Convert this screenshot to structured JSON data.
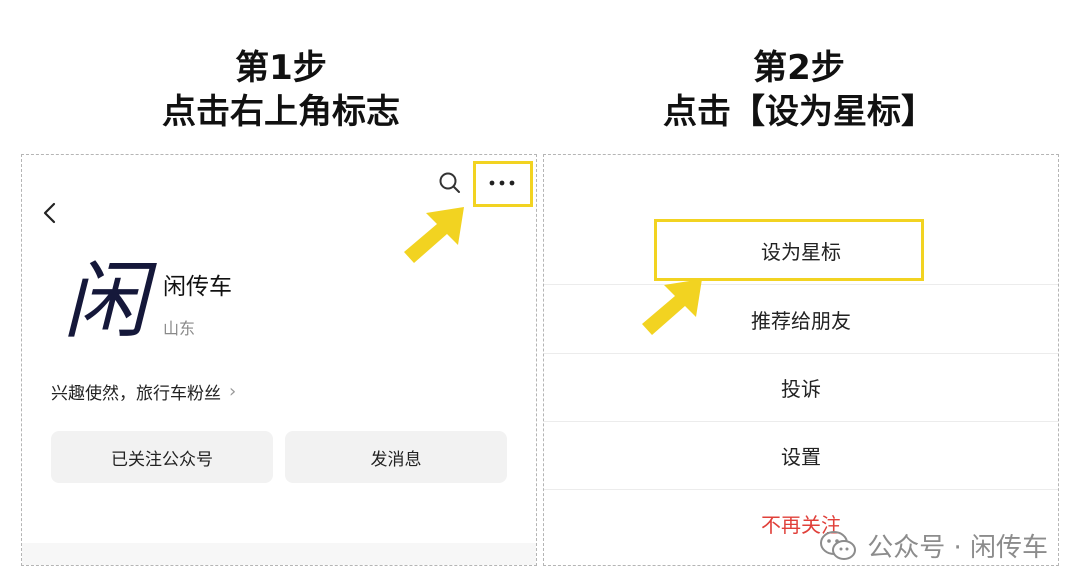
{
  "step1": {
    "title": "第1步",
    "subtitle": "点击右上角标志"
  },
  "step2": {
    "title": "第2步",
    "subtitle": "点击【设为星标】"
  },
  "profile": {
    "avatar_char": "闲",
    "name": "闲传车",
    "region": "山东",
    "description": "兴趣使然，旅行车粉丝",
    "follow_button": "已关注公众号",
    "message_button": "发消息",
    "icons": [
      "back-icon",
      "search-icon",
      "more-icon"
    ]
  },
  "menu": {
    "items": [
      {
        "label": "设为星标"
      },
      {
        "label": "推荐给朋友"
      },
      {
        "label": "投诉"
      },
      {
        "label": "设置"
      },
      {
        "label": "不再关注"
      }
    ]
  },
  "watermark": {
    "text": "公众号 · 闲传车",
    "icon": "wechat-icon"
  },
  "colors": {
    "highlight": "#f2d321",
    "danger": "#e0403a"
  }
}
